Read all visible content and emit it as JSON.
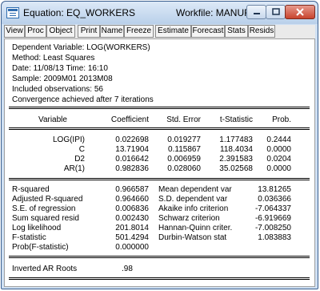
{
  "window": {
    "title_equation": "Equation: EQ_WORKERS",
    "title_workfile": "Workfile: MANUFACTURING::..."
  },
  "title_buttons": {
    "minimize": "–",
    "maximize": "□",
    "close": "✕"
  },
  "toolbar": [
    "View",
    "Proc",
    "Object",
    "Print",
    "Name",
    "Freeze",
    "Estimate",
    "Forecast",
    "Stats",
    "Resids"
  ],
  "header": {
    "dependent": "Dependent Variable: LOG(WORKERS)",
    "method": "Method: Least Squares",
    "date": "Date: 11/08/13   Time: 16:10",
    "sample": "Sample: 2009M01 2013M08",
    "observations": "Included observations: 56",
    "convergence": "Convergence achieved after 7 iterations"
  },
  "coef_table": {
    "columns": [
      "Variable",
      "Coefficient",
      "Std. Error",
      "t-Statistic",
      "Prob."
    ],
    "rows": [
      [
        "LOG(IPI)",
        "0.022698",
        "0.019277",
        "1.177483",
        "0.2444"
      ],
      [
        "C",
        "13.71904",
        "0.115867",
        "118.4034",
        "0.0000"
      ],
      [
        "D2",
        "0.016642",
        "0.006959",
        "2.391583",
        "0.0204"
      ],
      [
        "AR(1)",
        "0.982836",
        "0.028060",
        "35.02568",
        "0.0000"
      ]
    ]
  },
  "stats": {
    "left": [
      [
        "R-squared",
        "0.966587"
      ],
      [
        "Adjusted R-squared",
        "0.964660"
      ],
      [
        "S.E. of regression",
        "0.006836"
      ],
      [
        "Sum squared resid",
        "0.002430"
      ],
      [
        "Log likelihood",
        "201.8014"
      ],
      [
        "F-statistic",
        "501.4294"
      ],
      [
        "Prob(F-statistic)",
        "0.000000"
      ]
    ],
    "right": [
      [
        "Mean dependent var",
        "13.81265"
      ],
      [
        "S.D. dependent var",
        "0.036366"
      ],
      [
        "Akaike info criterion",
        "-7.064337"
      ],
      [
        "Schwarz criterion",
        "-6.919669"
      ],
      [
        "Hannan-Quinn criter.",
        "-7.008250"
      ],
      [
        "Durbin-Watson stat",
        "1.083883"
      ]
    ]
  },
  "roots": {
    "label": "Inverted AR Roots",
    "value": ".98"
  },
  "colors": {
    "titlebar": "#c8daf0",
    "close_button": "#c8432d",
    "toolbar": "#eaeaea"
  }
}
